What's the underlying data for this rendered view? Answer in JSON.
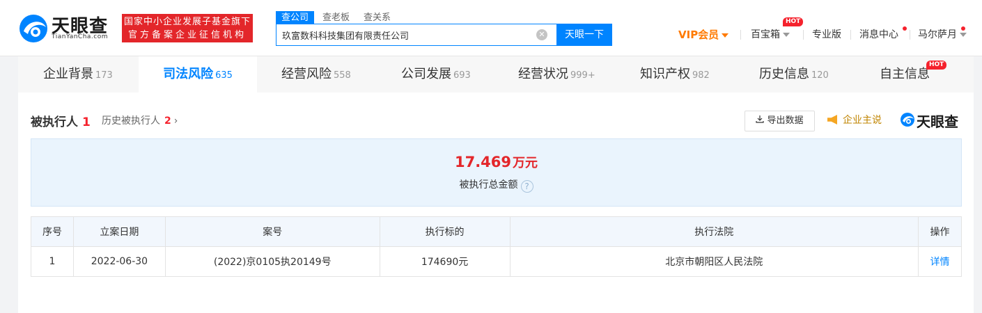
{
  "brand": {
    "name_cn": "天眼查",
    "name_en": "TianYanCha.com",
    "fund_line1": "国家中小企业发展子基金旗下",
    "fund_line2": "官方备案企业征信机构"
  },
  "search": {
    "tabs": [
      "查公司",
      "查老板",
      "查关系"
    ],
    "active_tab": "查公司",
    "value": "玖富数科科技集团有限责任公司",
    "button_label": "天眼一下"
  },
  "nav": {
    "vip_label": "VIP会员",
    "baibaoxiang_label": "百宝箱",
    "hot_badge": "HOT",
    "pro_label": "专业版",
    "messages_label": "消息中心",
    "user_label": "马尔萨月"
  },
  "tabs": [
    {
      "label": "企业背景",
      "count": "173"
    },
    {
      "label": "司法风险",
      "count": "635"
    },
    {
      "label": "经营风险",
      "count": "558"
    },
    {
      "label": "公司发展",
      "count": "693"
    },
    {
      "label": "经营状况",
      "count": "999+"
    },
    {
      "label": "知识产权",
      "count": "982"
    },
    {
      "label": "历史信息",
      "count": "120"
    },
    {
      "label": "自主信息",
      "count": "",
      "badge": "HOT"
    }
  ],
  "active_tab": "司法风险",
  "section": {
    "title": "被执行人",
    "count": "1",
    "history_label": "历史被执行人",
    "history_count": "2",
    "export_label": "导出数据",
    "promo_label": "企业主说",
    "brand_label": "天眼查"
  },
  "summary": {
    "amount": "17.469",
    "unit": "万元",
    "label": "被执行总金额",
    "help": "?"
  },
  "table": {
    "headers": [
      "序号",
      "立案日期",
      "案号",
      "执行标的",
      "执行法院",
      "操作"
    ],
    "rows": [
      [
        "1",
        "2022-06-30",
        "(2022)京0105执20149号",
        "174690元",
        "北京市朝阳区人民法院",
        "详情"
      ]
    ]
  }
}
